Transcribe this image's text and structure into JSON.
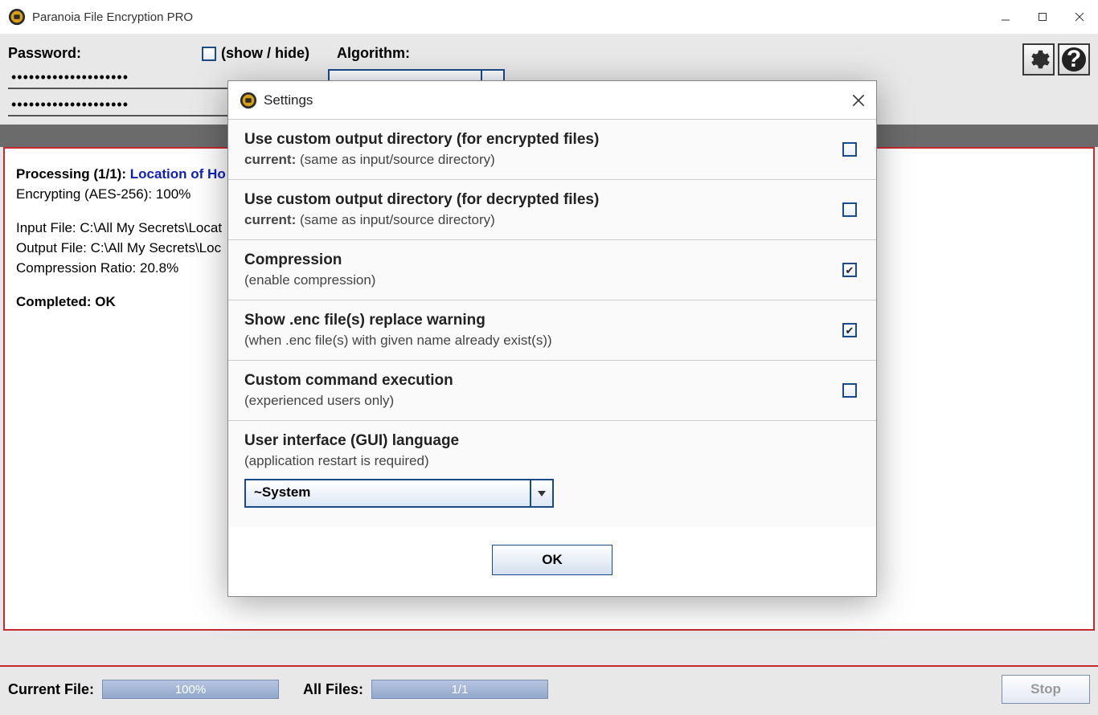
{
  "app_title": "Paranoia File Encryption PRO",
  "labels": {
    "password": "Password:",
    "show_hide": "(show / hide)",
    "algorithm": "Algorithm:"
  },
  "password_value_1": "••••••••••••••••••••",
  "password_value_2": "••••••••••••••••••••",
  "log": {
    "processing_prefix": "Processing (1/1): ",
    "processing_file": "Location of Ho",
    "enc_line": "Encrypting (AES-256): 100%",
    "input_line": "Input File: C:\\All My Secrets\\Locat",
    "output_line": "Output File: C:\\All My Secrets\\Loc",
    "ratio_line": "Compression Ratio: 20.8%",
    "completed": "Completed: OK"
  },
  "footer": {
    "current_file_label": "Current File:",
    "current_file_value": "100%",
    "all_files_label": "All Files:",
    "all_files_value": "1/1",
    "stop": "Stop"
  },
  "dialog": {
    "title": "Settings",
    "options": [
      {
        "title": "Use custom output directory (for encrypted files)",
        "sub_bold": "current:",
        "sub_rest": " (same as input/source directory)",
        "checked": false
      },
      {
        "title": "Use custom output directory (for decrypted files)",
        "sub_bold": "current:",
        "sub_rest": " (same as input/source directory)",
        "checked": false
      },
      {
        "title": "Compression",
        "sub_bold": "",
        "sub_rest": "(enable compression)",
        "checked": true
      },
      {
        "title": "Show .enc file(s) replace warning",
        "sub_bold": "",
        "sub_rest": "(when .enc file(s) with given name already exist(s))",
        "checked": true
      },
      {
        "title": "Custom command execution",
        "sub_bold": "",
        "sub_rest": "(experienced users only)",
        "checked": false
      }
    ],
    "lang_title": "User interface (GUI) language",
    "lang_sub": "(application restart is required)",
    "lang_value": "~System",
    "ok": "OK"
  }
}
